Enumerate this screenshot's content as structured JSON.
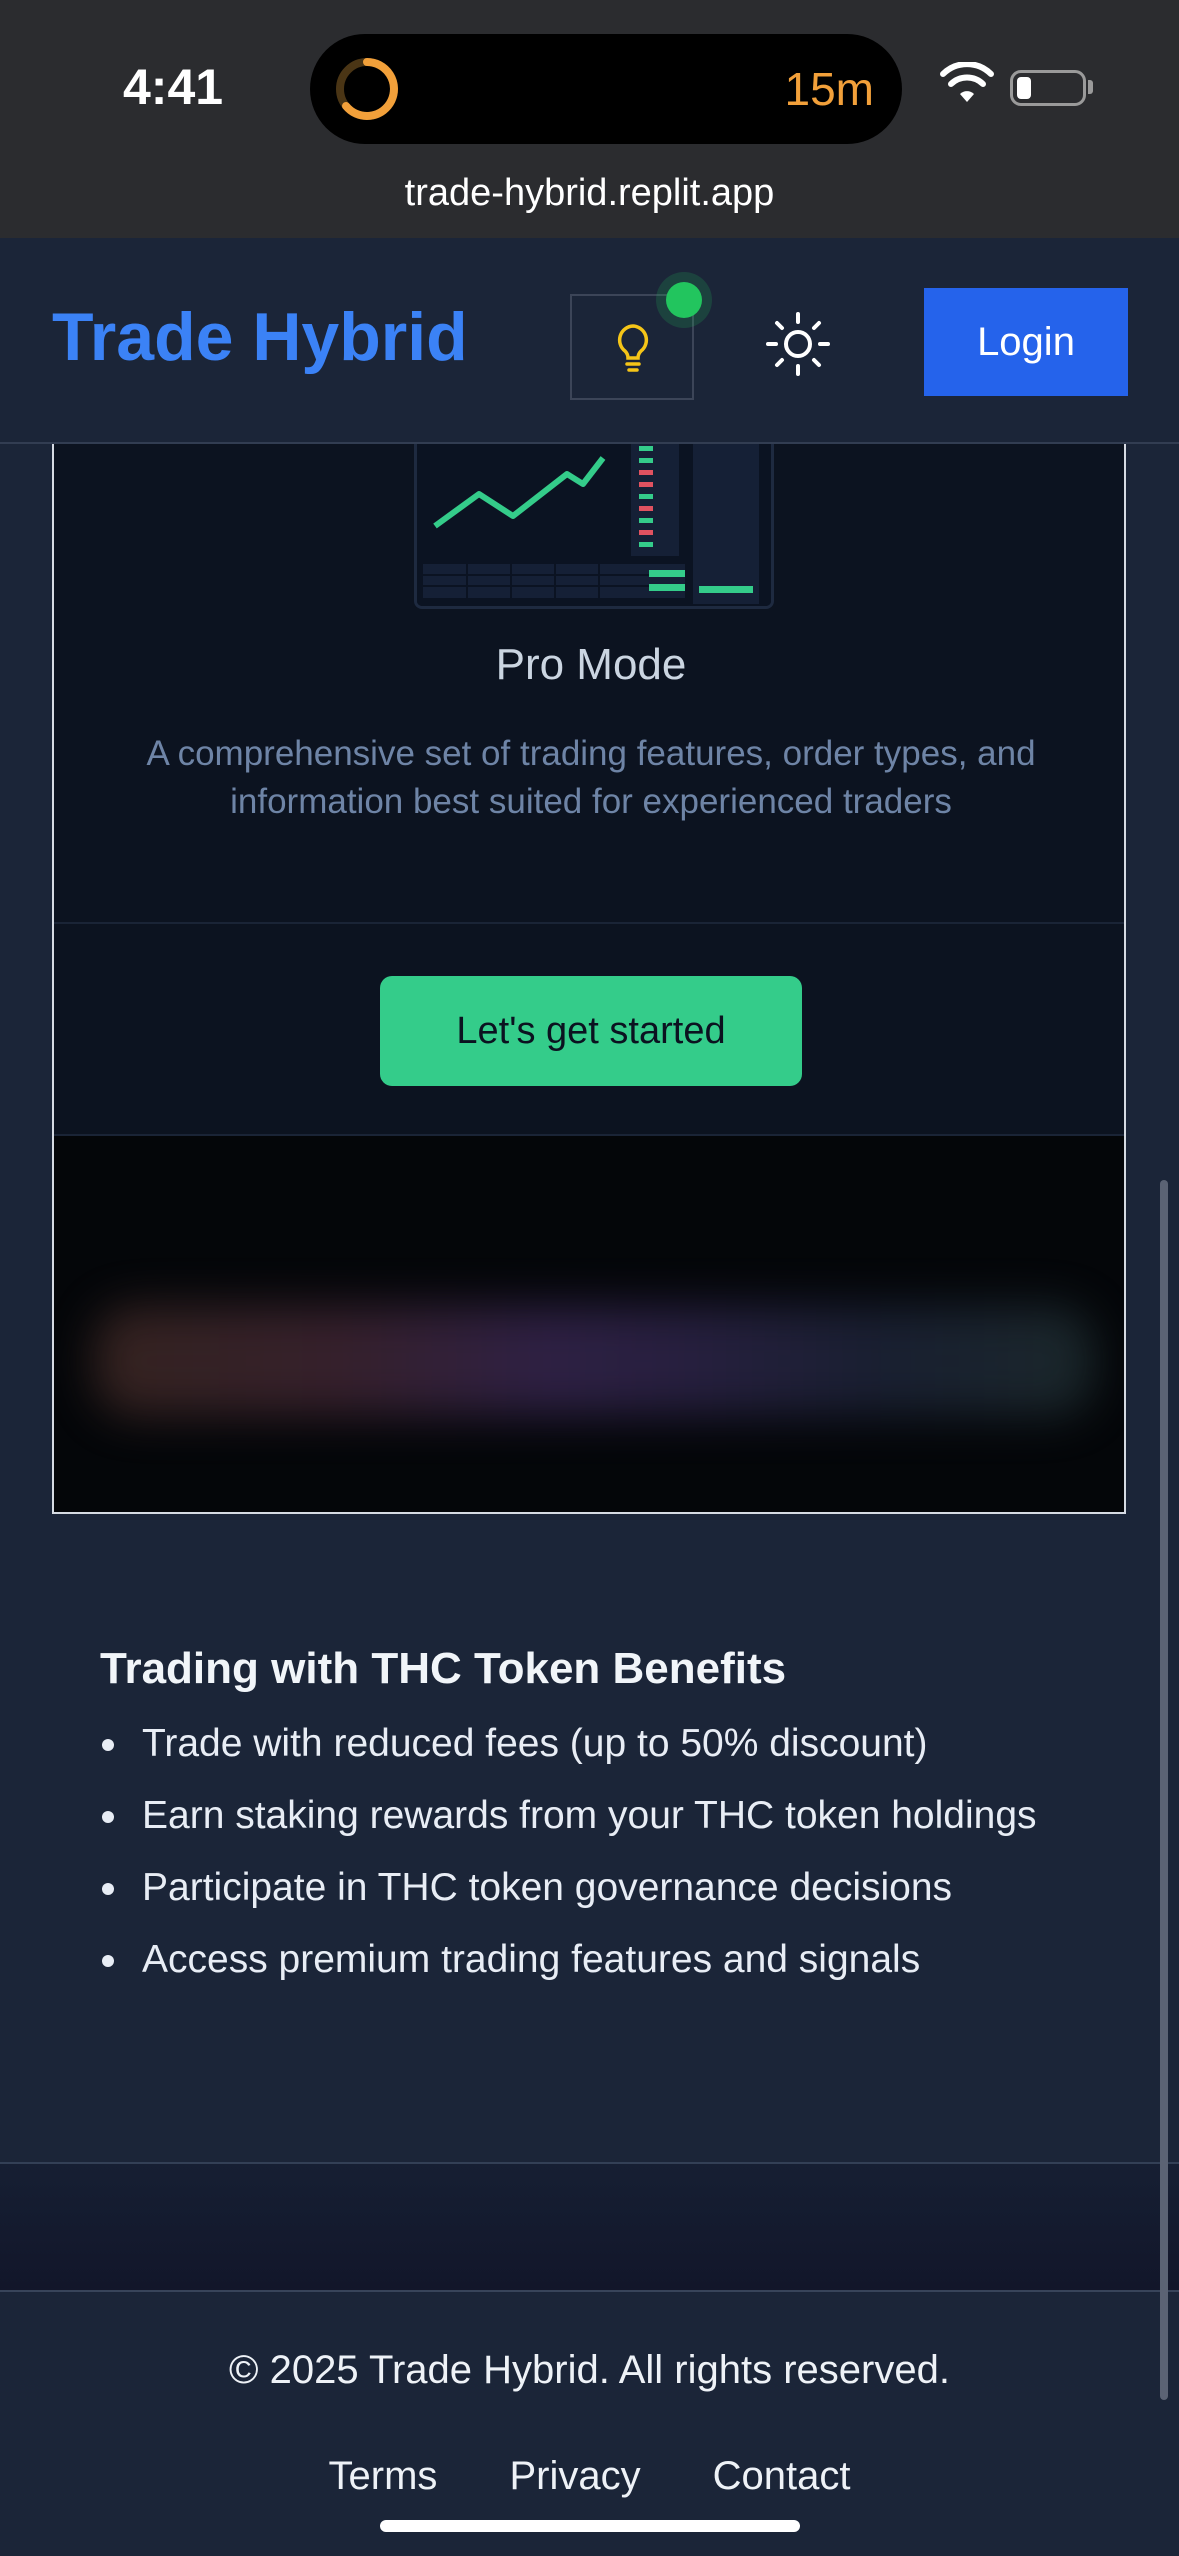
{
  "status_bar": {
    "time": "4:41",
    "timer": "15m",
    "url": "trade-hybrid.replit.app"
  },
  "header": {
    "brand": "Trade Hybrid",
    "login_label": "Login",
    "brand_color": "#3b82f6"
  },
  "card": {
    "mode_title": "Pro Mode",
    "mode_description": "A comprehensive set of trading features, order types, and information best suited for experienced traders",
    "cta_label": "Let's get started"
  },
  "benefits": {
    "title": "Trading with THC Token Benefits",
    "items": [
      "Trade with reduced fees (up to 50% discount)",
      "Earn staking rewards from your THC token holdings",
      "Participate in THC token governance decisions",
      "Access premium trading features and signals"
    ]
  },
  "footer": {
    "copyright": "© 2025 Trade Hybrid. All rights reserved.",
    "links": [
      "Terms",
      "Privacy",
      "Contact"
    ]
  },
  "colors": {
    "accent_green": "#34cc8a",
    "login_blue": "#2563eb",
    "background": "#1b2538"
  }
}
